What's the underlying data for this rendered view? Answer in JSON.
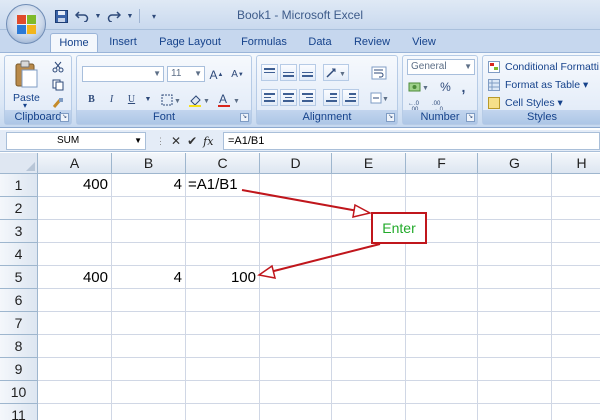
{
  "app": {
    "window_title": "Book1 - Microsoft Excel",
    "icons": {
      "save": "save-icon",
      "undo": "undo-icon",
      "redo": "redo-icon",
      "customize": "customize-qat-icon"
    }
  },
  "tabs": [
    {
      "label": "Home",
      "active": true
    },
    {
      "label": "Insert"
    },
    {
      "label": "Page Layout"
    },
    {
      "label": "Formulas"
    },
    {
      "label": "Data"
    },
    {
      "label": "Review"
    },
    {
      "label": "View"
    }
  ],
  "ribbon": {
    "clipboard": {
      "label": "Clipboard",
      "paste_label": "Paste"
    },
    "font": {
      "label": "Font",
      "font_name": "",
      "font_size": "11",
      "bold": "B",
      "italic": "I",
      "underline": "U"
    },
    "alignment": {
      "label": "Alignment"
    },
    "number": {
      "label": "Number",
      "format": "General",
      "percent": "%",
      "comma": ","
    },
    "styles": {
      "label": "Styles",
      "conditional_formatting": "Conditional Formatti",
      "format_as_table": "Format as Table",
      "cell_styles": "Cell Styles"
    }
  },
  "formula_bar": {
    "name_box": "SUM",
    "cancel": "✕",
    "enter": "✔",
    "fx": "fx",
    "formula": "=A1/B1"
  },
  "columns": [
    "A",
    "B",
    "C",
    "D",
    "E",
    "F",
    "G",
    "H"
  ],
  "rows": [
    "1",
    "2",
    "3",
    "4",
    "5",
    "6",
    "7",
    "8",
    "9",
    "10",
    "11"
  ],
  "cells": {
    "A1": "400",
    "B1": "4",
    "C1": "=A1/B1",
    "A5": "400",
    "B5": "4",
    "C5": "100"
  },
  "annotation": {
    "enter_label": "Enter",
    "colors": {
      "box_border": "#c0161c",
      "text": "#22aa2a",
      "arrow": "#c0161c"
    }
  }
}
